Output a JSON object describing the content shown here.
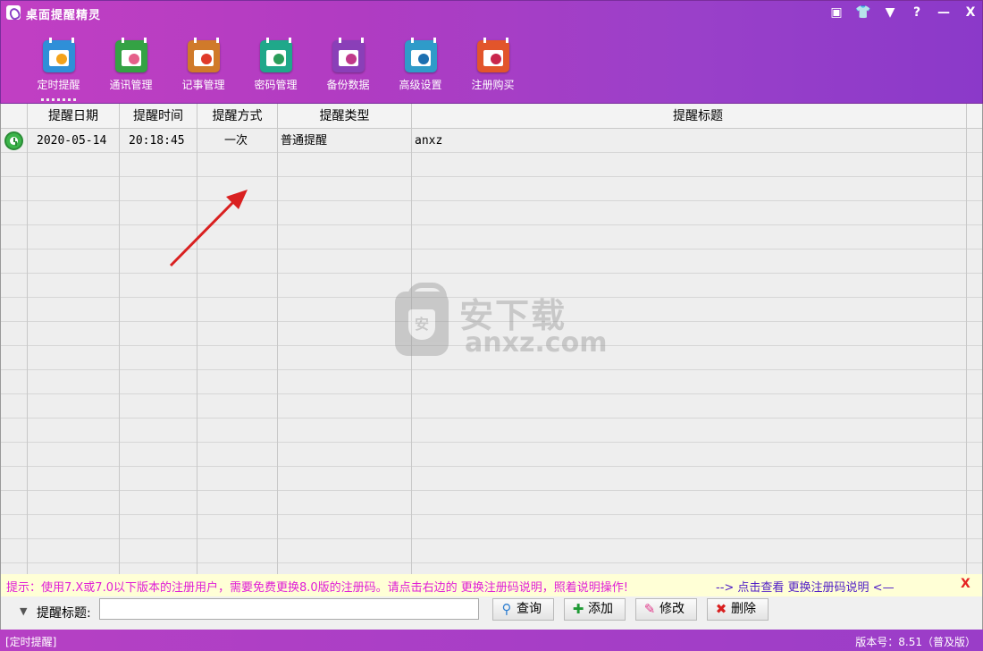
{
  "window": {
    "title": "桌面提醒精灵",
    "controls": [
      "▣",
      "👕",
      "▼",
      "?",
      "—",
      "X"
    ]
  },
  "toolbar": [
    {
      "label": "定时提醒",
      "icon": "clock-calendar-icon",
      "color": "#2f8fd8",
      "accent": "#f3a21b",
      "active": true
    },
    {
      "label": "通讯管理",
      "icon": "contacts-book-icon",
      "color": "#34a244",
      "accent": "#e55f8a",
      "active": false
    },
    {
      "label": "记事管理",
      "icon": "notepad-pen-icon",
      "color": "#d07a2a",
      "accent": "#e03a2a",
      "active": false
    },
    {
      "label": "密码管理",
      "icon": "password-folder-icon",
      "color": "#1fa88a",
      "accent": "#2a9d5a",
      "active": false
    },
    {
      "label": "备份数据",
      "icon": "backup-drive-icon",
      "color": "#8a3fb8",
      "accent": "#c0398a",
      "active": false
    },
    {
      "label": "高级设置",
      "icon": "settings-gear-icon",
      "color": "#2f9bc9",
      "accent": "#1c6fb0",
      "active": false
    },
    {
      "label": "注册购买",
      "icon": "register-cart-icon",
      "color": "#e2552b",
      "accent": "#c9264c",
      "active": false
    }
  ],
  "grid": {
    "columns": [
      "",
      "提醒日期",
      "提醒时间",
      "提醒方式",
      "提醒类型",
      "提醒标题"
    ],
    "rows": [
      {
        "date": "2020-05-14",
        "time": "20:18:45",
        "mode": "一次",
        "type": "普通提醒",
        "title": "anxz"
      }
    ]
  },
  "watermark": {
    "text": "安下载",
    "url": "anxz.com",
    "shield": "安"
  },
  "hint": {
    "text": "提示：使用7.X或7.0以下版本的注册用户，需要免费更换8.0版的注册码。请点击右边的 更换注册码说明，照着说明操作!",
    "link": "--> 点击查看 更换注册码说明 <—",
    "close": "X"
  },
  "search": {
    "label": "提醒标题:",
    "value": "",
    "placeholder": "",
    "buttons": {
      "query": "查询",
      "add": "添加",
      "edit": "修改",
      "delete": "删除"
    }
  },
  "status": {
    "left": "[定时提醒]",
    "right": "版本号：8.51（普及版）"
  }
}
